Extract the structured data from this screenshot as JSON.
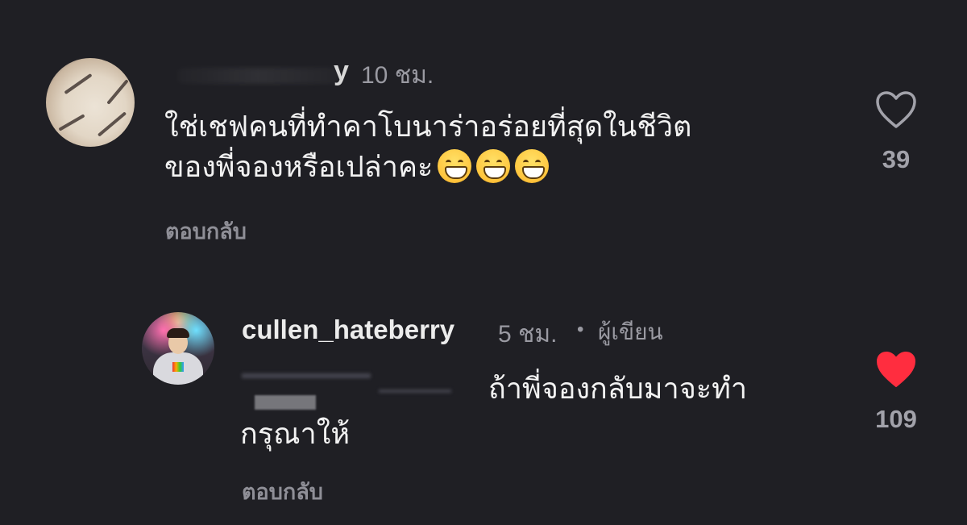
{
  "comments": [
    {
      "username": "",
      "username_tail": "y",
      "time": "10 ชม.",
      "author_badge": "",
      "text_line1": "ใช่เชฟคนที่ทำคาโบนาร่าอร่อยที่สุดในชีวิต",
      "text_line2": "ของพี่จองหรือเปล่าคะ",
      "emojis": [
        "grinning-face-emoji",
        "grinning-face-emoji",
        "grinning-face-emoji"
      ],
      "reply_label": "ตอบกลับ",
      "likes": "39",
      "liked": false
    },
    {
      "username": "cullen_hateberry",
      "time": "5 ชม.",
      "separator": "•",
      "author_badge": "ผู้เขียน",
      "text_line1": "ถ้าพี่จองกลับมาจะทำ",
      "text_line2": "กรุณาให้",
      "reply_label": "ตอบกลับ",
      "likes": "109",
      "liked": true
    }
  ],
  "colors": {
    "background": "#1f1f24",
    "like_red": "#ff2d3f",
    "muted": "#9a9aa2"
  }
}
